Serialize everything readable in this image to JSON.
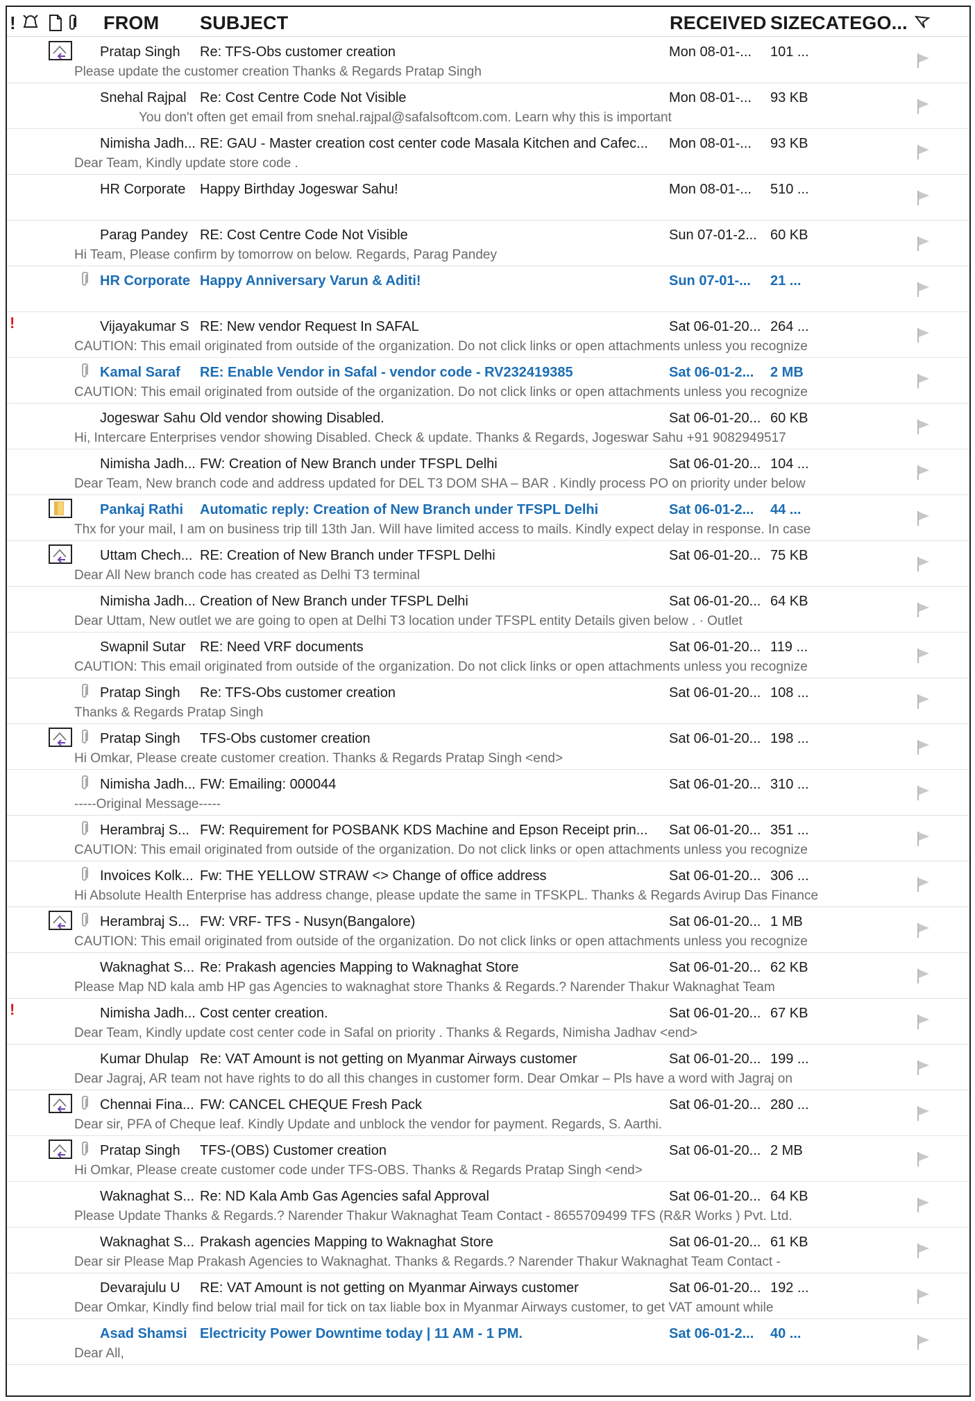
{
  "header": {
    "columns": {
      "from": "FROM",
      "subject": "SUBJECT",
      "received": "RECEIVED",
      "size": "SIZE",
      "category": "CATEGO..."
    },
    "icons": [
      "importance-icon",
      "reminder-icon",
      "item-type-icon",
      "attachment-icon",
      "flag-filter-icon"
    ]
  },
  "colors": {
    "unread": "#1b6db5",
    "importance": "#d81b1b",
    "preview": "#6a6a6a"
  },
  "emails": [
    {
      "from": "Pratap Singh",
      "subject": "Re: TFS-Obs customer creation",
      "received": "Mon 08-01-...",
      "size": "101 ...",
      "preview": "Please update the customer creation   Thanks & Regards  Pratap Singh",
      "unread": false,
      "icon": "replied",
      "attachment": false,
      "important": false,
      "indent": false
    },
    {
      "from": "Snehal Rajpal",
      "subject": "Re: Cost Centre Code Not Visible",
      "received": "Mon 08-01-...",
      "size": "93 KB",
      "preview": "You don't often get email from snehal.rajpal@safalsoftcom.com. Learn why this is important",
      "unread": false,
      "icon": "",
      "attachment": false,
      "important": false,
      "indent": true
    },
    {
      "from": "Nimisha Jadh...",
      "subject": "RE: GAU - Master creation cost center code Masala Kitchen and Cafec...",
      "received": "Mon 08-01-...",
      "size": "93 KB",
      "preview": "Dear Team,  Kindly update store code .",
      "unread": false,
      "icon": "",
      "attachment": false,
      "important": false,
      "indent": false
    },
    {
      "from": "HR Corporate",
      "subject": "Happy Birthday Jogeswar Sahu!",
      "received": "Mon 08-01-...",
      "size": "510 ...",
      "preview": "",
      "unread": false,
      "icon": "",
      "attachment": false,
      "important": false,
      "indent": false
    },
    {
      "from": "Parag Pandey",
      "subject": "RE: Cost Centre Code Not Visible",
      "received": "Sun 07-01-2...",
      "size": "60 KB",
      "preview": "Hi Team,  Please confirm by tomorrow on below.  Regards,  Parag Pandey",
      "unread": false,
      "icon": "",
      "attachment": false,
      "important": false,
      "indent": false
    },
    {
      "from": "HR Corporate",
      "subject": "Happy Anniversary Varun & Aditi!",
      "received": "Sun 07-01-...",
      "size": "21 ...",
      "preview": "",
      "unread": true,
      "icon": "",
      "attachment": true,
      "important": false,
      "indent": false
    },
    {
      "from": "Vijayakumar S",
      "subject": "RE: New vendor Request In SAFAL",
      "received": "Sat 06-01-20...",
      "size": "264 ...",
      "preview": "CAUTION: This email originated from outside of the organization. Do not click links or open attachments unless you recognize",
      "unread": false,
      "icon": "",
      "attachment": false,
      "important": true,
      "indent": false
    },
    {
      "from": "Kamal Saraf",
      "subject": "RE: Enable Vendor in Safal - vendor code - RV232419385",
      "received": "Sat 06-01-2...",
      "size": "2 MB",
      "preview": "CAUTION: This email originated from outside of the organization. Do not click links or open attachments unless you recognize",
      "unread": true,
      "icon": "",
      "attachment": true,
      "important": false,
      "indent": false
    },
    {
      "from": "Jogeswar Sahu",
      "subject": "Old vendor showing Disabled.",
      "received": "Sat 06-01-20...",
      "size": "60 KB",
      "preview": "Hi,  Intercare Enterprises vendor showing Disabled. Check & update.  Thanks & Regards,  Jogeswar Sahu   +91 9082949517",
      "unread": false,
      "icon": "",
      "attachment": false,
      "important": false,
      "indent": false
    },
    {
      "from": "Nimisha Jadh...",
      "subject": "FW: Creation of New Branch under TFSPL Delhi",
      "received": "Sat 06-01-20...",
      "size": "104 ...",
      "preview": "Dear Team,  New branch code and address updated for DEL T3 DOM SHA – BAR .  Kindly process PO on priority under below",
      "unread": false,
      "icon": "",
      "attachment": false,
      "important": false,
      "indent": false
    },
    {
      "from": "Pankaj Rathi",
      "subject": "Automatic reply: Creation of New Branch under TFSPL Delhi",
      "received": "Sat 06-01-2...",
      "size": "44 ...",
      "preview": "Thx for your mail, I am on business trip till 13th Jan.  Will have limited access to mails.  Kindly expect delay in response.  In case",
      "unread": true,
      "icon": "autoreply",
      "attachment": false,
      "important": false,
      "indent": false
    },
    {
      "from": "Uttam Chech...",
      "subject": "RE: Creation of New Branch under TFSPL Delhi",
      "received": "Sat 06-01-20...",
      "size": "75 KB",
      "preview": "Dear All  New branch code has created as Delhi T3 terminal",
      "unread": false,
      "icon": "replied",
      "attachment": false,
      "important": false,
      "indent": false
    },
    {
      "from": "Nimisha Jadh...",
      "subject": "Creation of New Branch under TFSPL Delhi",
      "received": "Sat 06-01-20...",
      "size": "64 KB",
      "preview": "Dear Uttam,  New outlet we are going to open at Delhi T3 location under TFSPL entity Details given below .  ·         Outlet",
      "unread": false,
      "icon": "",
      "attachment": false,
      "important": false,
      "indent": false
    },
    {
      "from": "Swapnil Sutar",
      "subject": "RE: Need VRF documents",
      "received": "Sat 06-01-20...",
      "size": "119 ...",
      "preview": "CAUTION: This email originated from outside of the organization. Do not click links or open attachments unless you recognize",
      "unread": false,
      "icon": "",
      "attachment": false,
      "important": false,
      "indent": false
    },
    {
      "from": "Pratap Singh",
      "subject": "Re: TFS-Obs customer creation",
      "received": "Sat 06-01-20...",
      "size": "108 ...",
      "preview": "Thanks & Regards  Pratap Singh",
      "unread": false,
      "icon": "",
      "attachment": true,
      "important": false,
      "indent": false
    },
    {
      "from": "Pratap Singh",
      "subject": "TFS-Obs customer creation",
      "received": "Sat 06-01-20...",
      "size": "198 ...",
      "preview": "Hi Omkar,  Please create customer creation.  Thanks & Regards  Pratap Singh  <end>",
      "unread": false,
      "icon": "replied",
      "attachment": true,
      "important": false,
      "indent": false
    },
    {
      "from": "Nimisha Jadh...",
      "subject": "FW: Emailing: 000044",
      "received": "Sat 06-01-20...",
      "size": "310 ...",
      "preview": "-----Original Message-----",
      "unread": false,
      "icon": "",
      "attachment": true,
      "important": false,
      "indent": false
    },
    {
      "from": "Herambraj S...",
      "subject": "FW: Requirement for POSBANK KDS Machine and Epson Receipt prin...",
      "received": "Sat 06-01-20...",
      "size": "351 ...",
      "preview": "CAUTION: This email originated from outside of the organization. Do not click links or open attachments unless you recognize",
      "unread": false,
      "icon": "",
      "attachment": true,
      "important": false,
      "indent": false
    },
    {
      "from": "Invoices Kolk...",
      "subject": "Fw: THE YELLOW STRAW <> Change of office address",
      "received": "Sat 06-01-20...",
      "size": "306 ...",
      "preview": "Hi  Absolute Health Enterprise has address change, please update the same in TFSKPL.  Thanks & Regards  Avirup Das  Finance",
      "unread": false,
      "icon": "",
      "attachment": true,
      "important": false,
      "indent": false
    },
    {
      "from": "Herambraj S...",
      "subject": "FW: VRF- TFS - Nusyn(Bangalore)",
      "received": "Sat 06-01-20...",
      "size": "1 MB",
      "preview": "CAUTION: This email originated from outside of the organization. Do not click links or open attachments unless you recognize",
      "unread": false,
      "icon": "replied",
      "attachment": true,
      "important": false,
      "indent": false
    },
    {
      "from": "Waknaghat S...",
      "subject": "Re: Prakash agencies Mapping to Waknaghat Store",
      "received": "Sat 06-01-20...",
      "size": "62 KB",
      "preview": "Please Map ND kala amb HP gas Agencies to waknaghat store  Thanks & Regards.?  Narender Thakur  Waknaghat Team",
      "unread": false,
      "icon": "",
      "attachment": false,
      "important": false,
      "indent": false
    },
    {
      "from": "Nimisha Jadh...",
      "subject": "Cost center creation.",
      "received": "Sat 06-01-20...",
      "size": "67 KB",
      "preview": "Dear Team,  Kindly update cost center code in Safal on priority .  Thanks & Regards,  Nimisha Jadhav <end>",
      "unread": false,
      "icon": "",
      "attachment": false,
      "important": true,
      "indent": false
    },
    {
      "from": "Kumar Dhulap",
      "subject": "Re: VAT Amount is not getting on Myanmar Airways customer",
      "received": "Sat 06-01-20...",
      "size": "199 ...",
      "preview": "Dear Jagraj,  AR team not have rights to do all this changes in customer form.  Dear Omkar – Pls have a word with Jagraj on",
      "unread": false,
      "icon": "",
      "attachment": false,
      "important": false,
      "indent": false
    },
    {
      "from": "Chennai Fina...",
      "subject": "FW: CANCEL CHEQUE Fresh Pack",
      "received": "Sat 06-01-20...",
      "size": "280 ...",
      "preview": "Dear sir,  PFA of Cheque leaf.  Kindly Update and unblock the vendor for payment.  Regards,  S. Aarthi.",
      "unread": false,
      "icon": "replied",
      "attachment": true,
      "important": false,
      "indent": false
    },
    {
      "from": "Pratap Singh",
      "subject": "TFS-(OBS) Customer creation",
      "received": "Sat 06-01-20...",
      "size": "2 MB",
      "preview": "Hi Omkar,  Please create customer code under TFS-OBS.  Thanks & Regards  Pratap Singh <end>",
      "unread": false,
      "icon": "replied",
      "attachment": true,
      "important": false,
      "indent": false
    },
    {
      "from": "Waknaghat S...",
      "subject": "Re: ND Kala Amb Gas Agencies safal Approval",
      "received": "Sat 06-01-20...",
      "size": "64 KB",
      "preview": "Please Update  Thanks & Regards.?  Narender Thakur  Waknaghat Team  Contact - 8655709499  TFS (R&R Works ) Pvt. Ltd.",
      "unread": false,
      "icon": "",
      "attachment": false,
      "important": false,
      "indent": false
    },
    {
      "from": "Waknaghat S...",
      "subject": "Prakash agencies Mapping to Waknaghat Store",
      "received": "Sat 06-01-20...",
      "size": "61 KB",
      "preview": "Dear sir  Please Map Prakash Agencies to Waknaghat.  Thanks & Regards.?  Narender Thakur  Waknaghat Team  Contact -",
      "unread": false,
      "icon": "",
      "attachment": false,
      "important": false,
      "indent": false
    },
    {
      "from": "Devarajulu U",
      "subject": "RE: VAT Amount is not getting on Myanmar Airways customer",
      "received": "Sat 06-01-20...",
      "size": "192 ...",
      "preview": "Dear Omkar,  Kindly find below trial mail for tick on tax liable box in Myanmar Airways customer, to get VAT amount while",
      "unread": false,
      "icon": "",
      "attachment": false,
      "important": false,
      "indent": false
    },
    {
      "from": "Asad Shamsi",
      "subject": "Electricity Power Downtime today | 11 AM - 1 PM.",
      "received": "Sat 06-01-2...",
      "size": "40 ...",
      "preview": "Dear All,",
      "unread": true,
      "icon": "",
      "attachment": false,
      "important": false,
      "indent": false
    }
  ]
}
